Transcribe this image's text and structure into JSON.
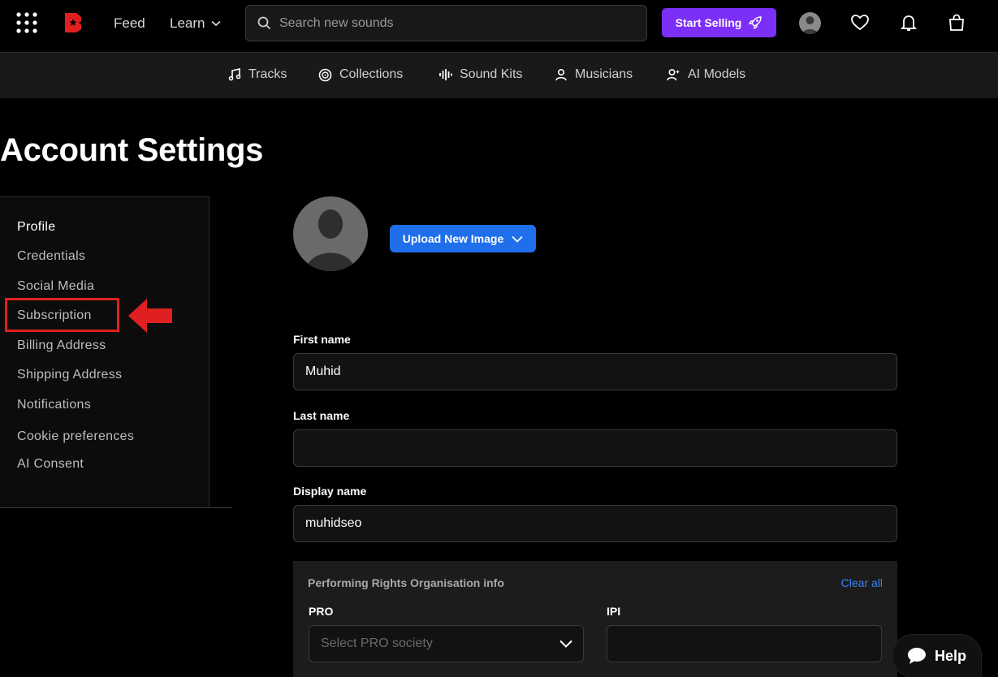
{
  "header": {
    "feed_label": "Feed",
    "learn_label": "Learn",
    "search_placeholder": "Search new sounds",
    "start_selling_label": "Start Selling"
  },
  "subnav": {
    "items": [
      {
        "label": "Tracks",
        "icon": "music-note-icon"
      },
      {
        "label": "Collections",
        "icon": "vinyl-icon"
      },
      {
        "label": "Sound Kits",
        "icon": "waveform-icon"
      },
      {
        "label": "Musicians",
        "icon": "person-icon"
      },
      {
        "label": "AI Models",
        "icon": "ai-person-icon"
      }
    ]
  },
  "page": {
    "title": "Account Settings"
  },
  "sidebar": {
    "items": [
      {
        "label": "Profile"
      },
      {
        "label": "Credentials"
      },
      {
        "label": "Social Media"
      },
      {
        "label": "Subscription"
      },
      {
        "label": "Billing Address"
      },
      {
        "label": "Shipping Address"
      },
      {
        "label": "Notifications"
      },
      {
        "label": "Cookie preferences"
      },
      {
        "label": "AI Consent"
      }
    ]
  },
  "profile": {
    "upload_label": "Upload New Image"
  },
  "form": {
    "first_name_label": "First name",
    "first_name_value": "Muhid",
    "last_name_label": "Last name",
    "last_name_value": "",
    "display_name_label": "Display name",
    "display_name_value": "muhidseo"
  },
  "pro": {
    "title": "Performing Rights Organisation info",
    "clear_all": "Clear all",
    "pro_label": "PRO",
    "pro_placeholder": "Select PRO society",
    "ipi_label": "IPI"
  },
  "help": {
    "label": "Help"
  },
  "colors": {
    "accent_purple": "#7b2ff7",
    "accent_blue": "#1f6feb",
    "brand_red": "#e02020",
    "link_blue": "#3b82f6"
  }
}
